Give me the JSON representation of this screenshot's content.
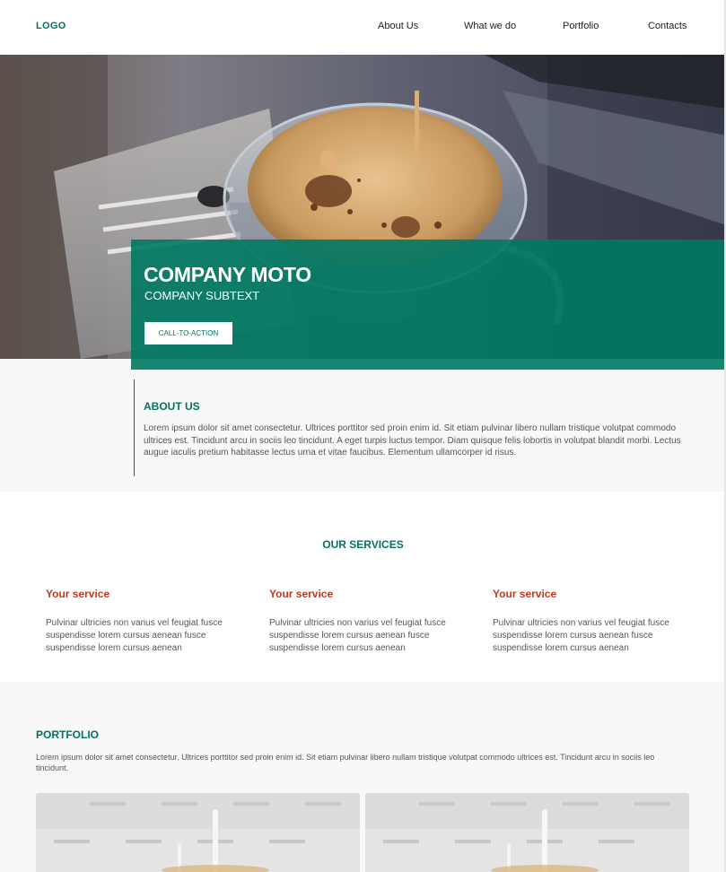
{
  "header": {
    "logo": "LOGO",
    "nav": [
      "About Us",
      "What we do",
      "Portfolio",
      "Contacts"
    ]
  },
  "hero": {
    "title": "COMPANY MOTO",
    "subtitle": "COMPANY SUBTEXT",
    "cta_label": "CALL-TO-ACTION"
  },
  "about": {
    "title": "ABOUT US",
    "text": "Lorem ipsum dolor sit amet consectetur. Ultrices porttitor sed proin enim id. Sit etiam pulvinar libero nullam tristique volutpat commodo ultrices est. Tincidunt arcu in sociis leo tincidunt. A eget turpis luctus tempor. Diam quisque felis lobortis in volutpat blandit morbi. Lectus augue iaculis pretium habitasse lectus urna et vitae faucibus. Elementum ullamcorper id risus."
  },
  "services": {
    "title": "OUR SERVICES",
    "items": [
      {
        "name": "Your service",
        "text": "Pulvinar ultricies non varius vel feugiat fusce suspendisse lorem cursus aenean fusce suspendisse lorem cursus aenean"
      },
      {
        "name": "Your service",
        "text": "Pulvinar ultricies non varius vel feugiat fusce suspendisse lorem cursus aenean fusce suspendisse lorem cursus aenean"
      },
      {
        "name": "Your service",
        "text": "Pulvinar ultricies non varius vel feugiat fusce suspendisse lorem cursus aenean fusce suspendisse lorem cursus aenean"
      }
    ]
  },
  "portfolio": {
    "title": "PORTFOLIO",
    "text": "Lorem ipsum dolor sit amet consectetur. Ultrices porttitor sed proin enim id. Sit etiam pulvinar libero nullam tristique volutpat commodo ultrices est. Tincidunt arcu in sociis leo tincidunt."
  },
  "colors": {
    "accent": "#00745f",
    "service_heading": "#c0391b",
    "band_background": "#f8f8f8"
  },
  "icons": {
    "hero_image": "coffee-espresso-photo",
    "portfolio_image": "cake-candles-photo"
  }
}
